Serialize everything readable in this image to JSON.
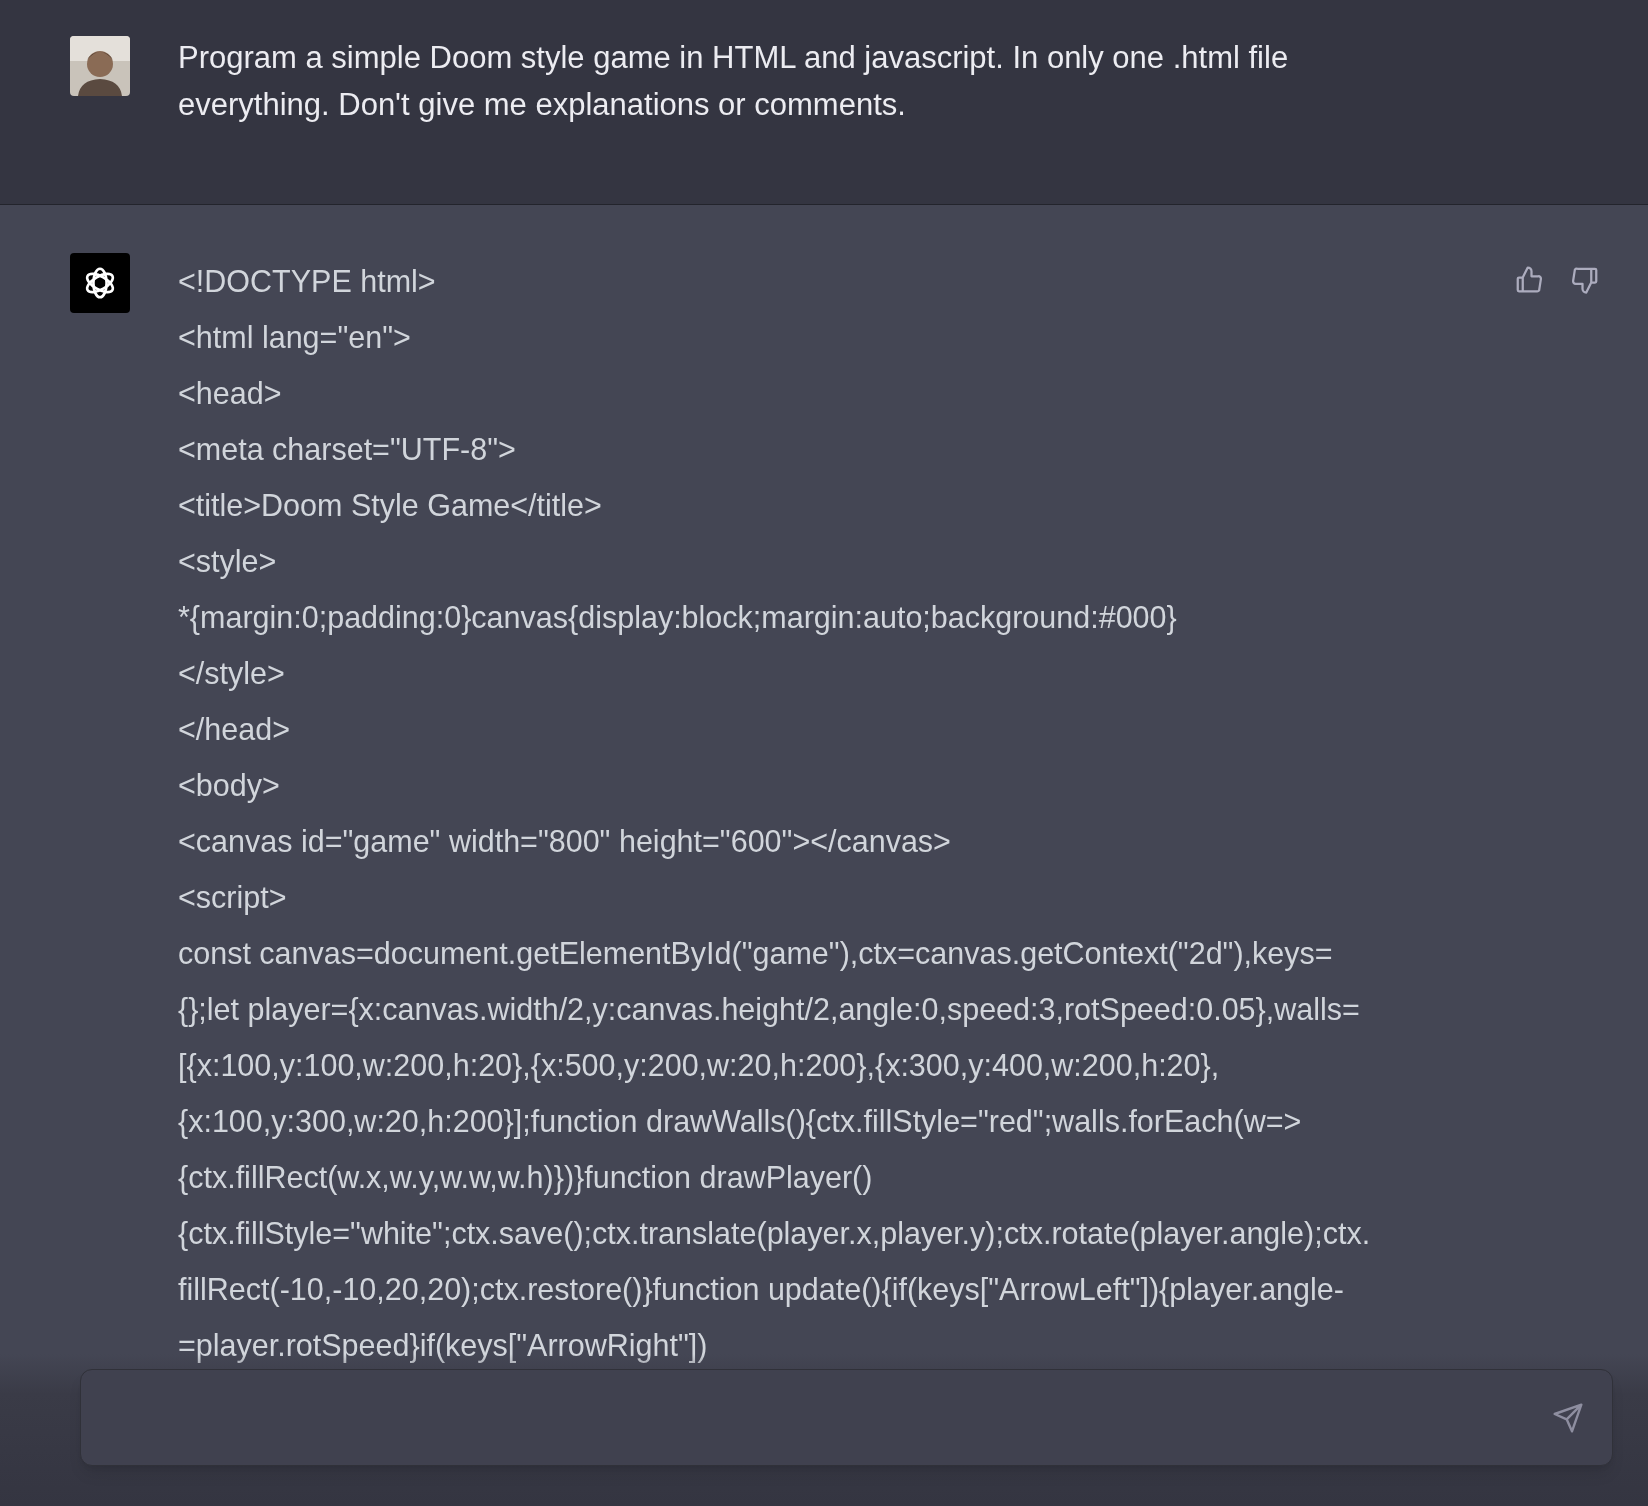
{
  "messages": [
    {
      "kind": "user",
      "text": "Program a simple Doom style game in HTML and javascript. In only one .html file everything. Don't give me explanations or comments."
    },
    {
      "kind": "assistant",
      "lines": [
        "<!DOCTYPE html>",
        "<html lang=\"en\">",
        "<head>",
        "<meta charset=\"UTF-8\">",
        "<title>Doom Style Game</title>",
        "<style>",
        "*{margin:0;padding:0}canvas{display:block;margin:auto;background:#000}",
        "</style>",
        "</head>",
        "<body>",
        "<canvas id=\"game\" width=\"800\" height=\"600\"></canvas>",
        "<script>",
        "const canvas=document.getElementById(\"game\"),ctx=canvas.getContext(\"2d\"),keys=",
        "{};let player={x:canvas.width/2,y:canvas.height/2,angle:0,speed:3,rotSpeed:0.05},walls=",
        "[{x:100,y:100,w:200,h:20},{x:500,y:200,w:20,h:200},{x:300,y:400,w:200,h:20},",
        "{x:100,y:300,w:20,h:200}];function drawWalls(){ctx.fillStyle=\"red\";walls.forEach(w=>",
        "{ctx.fillRect(w.x,w.y,w.w,w.h)})}function drawPlayer()",
        "{ctx.fillStyle=\"white\";ctx.save();ctx.translate(player.x,player.y);ctx.rotate(player.angle);ctx.",
        "fillRect(-10,-10,20,20);ctx.restore()}function update(){if(keys[\"ArrowLeft\"]){player.angle-",
        "=player.rotSpeed}if(keys[\"ArrowRight\"])"
      ]
    }
  ]
}
